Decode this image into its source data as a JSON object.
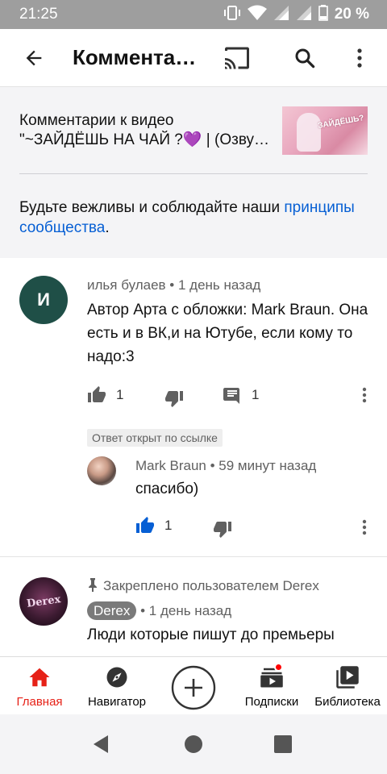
{
  "status_bar": {
    "time": "21:25",
    "battery": "20 %",
    "icons": [
      "vibrate-icon",
      "wifi-icon",
      "signal-icon",
      "signal-icon",
      "battery-icon"
    ]
  },
  "app_bar": {
    "title": "Комментарии",
    "icons": [
      "back-arrow-icon",
      "cast-icon",
      "search-icon",
      "more-vert-icon"
    ]
  },
  "video_header": {
    "title_line1": "Комментарии к видео",
    "title_line2": "\"~ЗАЙДЁШЬ НА ЧАЙ ?💜 | (Озвучка)",
    "thumbnail_text": "ЗАЙДЁШЬ?",
    "policy_text": "Будьте вежливы и соблюдайте наши",
    "policy_link": "принципы сообщества",
    "policy_end": "."
  },
  "comments": [
    {
      "author": "илья булаев",
      "time": "1 день назад",
      "avatar_letter": "И",
      "avatar_color": "#1f4f47",
      "text": "Автор Арта с обложки: Mark Braun. Она есть и в ВК,и на Ютубе, если кому то надо:3",
      "likes": "1",
      "replies": "1"
    },
    {
      "badge": "Ответ открыт по ссылке",
      "author": "Mark Braun",
      "time": "59 минут назад",
      "text": "спасибо)",
      "likes": "1",
      "liked": true
    },
    {
      "pinned_text": "Закреплено пользователем Derex",
      "author": "Derex",
      "avatar_text": "Derex",
      "time": "1 день назад",
      "text": "Люди которые пишут до премьеры"
    }
  ],
  "bottom_nav": {
    "items": [
      {
        "label": "Главная",
        "icon": "home-icon",
        "active": true
      },
      {
        "label": "Навигатор",
        "icon": "compass-icon"
      },
      {
        "label": "",
        "icon": "add-circle-icon"
      },
      {
        "label": "Подписки",
        "icon": "subscriptions-icon",
        "has_dot": true
      },
      {
        "label": "Библиотека",
        "icon": "library-icon"
      }
    ]
  },
  "colors": {
    "accent_red": "#e62117",
    "link_blue": "#065fd4",
    "header_bg": "#f4f4f6",
    "status_bar": "#9e9e9e"
  }
}
